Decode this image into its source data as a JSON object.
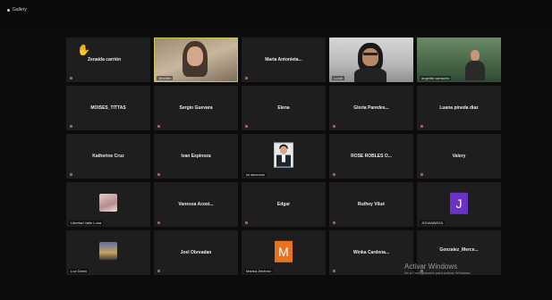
{
  "toolbar": {
    "view_label": "Gallery"
  },
  "tiles": [
    {
      "name": "Zenaida carrión",
      "hand": "✋"
    },
    {
      "label": "Jennifer"
    },
    {
      "name": "Maria Antonieta..."
    },
    {
      "label": "Lucía"
    },
    {
      "label": "angelita camacho"
    },
    {
      "name": "MOISES_TITTAS"
    },
    {
      "name": "Sergio Guevara"
    },
    {
      "name": "Elena"
    },
    {
      "name": "Gloria Paredes..."
    },
    {
      "name": "Luana pineda díaz"
    },
    {
      "name": "Katherine Cruz"
    },
    {
      "name": "Ivan Espinoza"
    },
    {
      "label": "lui ascencio"
    },
    {
      "name": "ROSE ROBLES O..."
    },
    {
      "name": "Valery"
    },
    {
      "label": "Libertad Valle Luna"
    },
    {
      "name": "Vanessa Acost..."
    },
    {
      "name": "Edgar"
    },
    {
      "name": "Ruthey Vilué"
    },
    {
      "label": "JOHANNEZA",
      "initial": "J",
      "color": "#6b33c5"
    },
    {
      "label": "Luz Danio"
    },
    {
      "name": "Joel Obreadan"
    },
    {
      "label": "Marisa Jiménez",
      "initial": "M",
      "color": "#e8731d"
    },
    {
      "name": "Winka Cardena..."
    },
    {
      "name": "Gonzalez_Merce..."
    }
  ],
  "watermark": {
    "title": "Activar Windows",
    "subtitle": "Ve a Configuración para activar Windows."
  },
  "colors": {
    "background": "#0c0c0c",
    "tile": "#1e1e1e",
    "active_speaker_border": "#c9c45a"
  }
}
